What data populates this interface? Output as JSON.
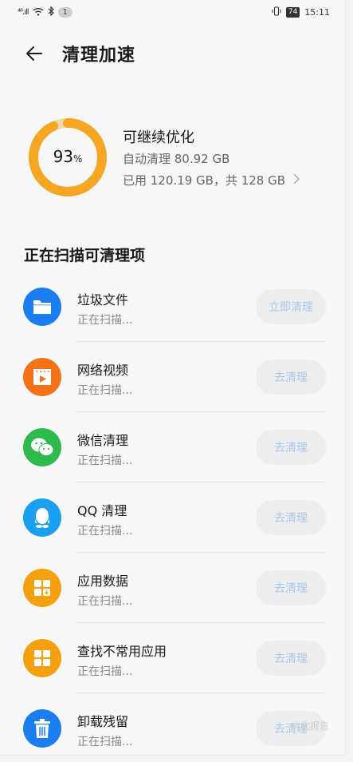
{
  "status_bar": {
    "signal": "⁴⁶.ıll",
    "badge": "1",
    "battery": "74",
    "time": "15:11"
  },
  "header": {
    "title": "清理加速",
    "back_icon": "back-arrow-icon"
  },
  "summary": {
    "percent_value": "93",
    "percent_sign": "%",
    "percent_fraction": 0.93,
    "headline": "可继续优化",
    "auto_clean": "自动清理 80.92 GB",
    "usage": "已用 120.19 GB，共 128 GB",
    "ring_color": "#f5a623",
    "ring_track_color": "#f0d9a8"
  },
  "section_title": "正在扫描可清理项",
  "items": [
    {
      "title": "垃圾文件",
      "status": "正在扫描...",
      "button": "立即清理",
      "icon": "folder-icon",
      "color": "#1a7ef0"
    },
    {
      "title": "网络视频",
      "status": "正在扫描...",
      "button": "去清理",
      "icon": "video-icon",
      "color": "#f57316"
    },
    {
      "title": "微信清理",
      "status": "正在扫描...",
      "button": "去清理",
      "icon": "wechat-icon",
      "color": "#2dbb4e"
    },
    {
      "title": "QQ 清理",
      "status": "正在扫描...",
      "button": "去清理",
      "icon": "qq-icon",
      "color": "#1aa0f0"
    },
    {
      "title": "应用数据",
      "status": "正在扫描...",
      "button": "去清理",
      "icon": "app-data-icon",
      "color": "#f5a00f"
    },
    {
      "title": "查找不常用应用",
      "status": "正在扫描...",
      "button": "去清理",
      "icon": "apps-grid-icon",
      "color": "#f5a00f"
    },
    {
      "title": "卸载残留",
      "status": "正在扫描...",
      "button": "去清理",
      "icon": "trash-icon",
      "color": "#1a7ef0"
    }
  ],
  "watermark": "优化报告"
}
